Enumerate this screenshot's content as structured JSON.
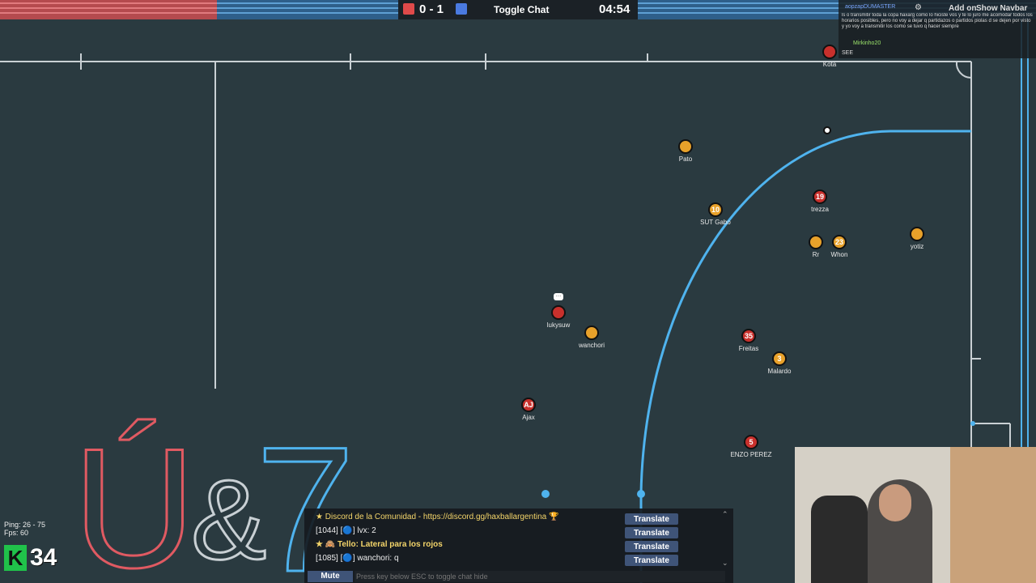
{
  "scoreboard": {
    "red_color": "#e04a4a",
    "blue_color": "#4a7ae0",
    "score": "0 - 1",
    "toggle_chat": "Toggle Chat",
    "timer": "04:54"
  },
  "top_chat": {
    "user1": "aopzapDUMASTER",
    "message1": "ls o transmitir toda la copa haxarg como lo hiciste vos y te lo juro me acomodar todos los horarios posibles, pero no voy a dejar q partidazos o partidos piolas d se dejen por visto y yo voy a transmitir los como se tuvo q hacer siempre",
    "user2": "Mirkinho20",
    "message2": "SEE",
    "add_on": "Add on",
    "show_navbar": "Show Navbar"
  },
  "players": [
    {
      "name": "Kota",
      "team": "red",
      "label": ""
    },
    {
      "name": "Pato",
      "team": "blue",
      "label": ""
    },
    {
      "name": "SUT Gabo",
      "team": "blue",
      "label": "10"
    },
    {
      "name": "trezza",
      "team": "red",
      "label": "19"
    },
    {
      "name": "Rr",
      "team": "blue",
      "label": ""
    },
    {
      "name": "Whon",
      "team": "blue",
      "label": "23"
    },
    {
      "name": "yotiz",
      "team": "blue",
      "label": ""
    },
    {
      "name": "lukysuw",
      "team": "red",
      "label": ""
    },
    {
      "name": "wanchori",
      "team": "blue",
      "label": ""
    },
    {
      "name": "Freitas",
      "team": "red",
      "label": "35"
    },
    {
      "name": "Malardo",
      "team": "blue",
      "label": "3"
    },
    {
      "name": "Ajax",
      "team": "red",
      "label": "AJ"
    },
    {
      "name": "ENZO PEREZ",
      "team": "red",
      "label": "5"
    }
  ],
  "stats": {
    "ping": "Ping: 26 - 75",
    "fps": "Fps: 60",
    "logo_letter": "K",
    "logo_number": "34"
  },
  "logo_text": {
    "letter": "Ú",
    "amp": "&",
    "seven": "7"
  },
  "chat": {
    "lines": [
      {
        "prefix": "★",
        "text": "Discord de la Comunidad - https://discord.gg/haxballargentina 🏆",
        "color": "#f4d56a"
      },
      {
        "prefix": "[1044]",
        "text": "[🔵] lvx: 2",
        "color": "#eeeeee"
      },
      {
        "prefix": "★ 🙈",
        "text": "Tello: Lateral para los rojos",
        "color": "#f4d56a"
      },
      {
        "prefix": "[1085]",
        "text": "[🔵] wanchori: q",
        "color": "#eeeeee"
      }
    ],
    "translate_label": "Translate",
    "mute": "Mute",
    "input_placeholder": "Press key below ESC to toggle chat hide"
  }
}
